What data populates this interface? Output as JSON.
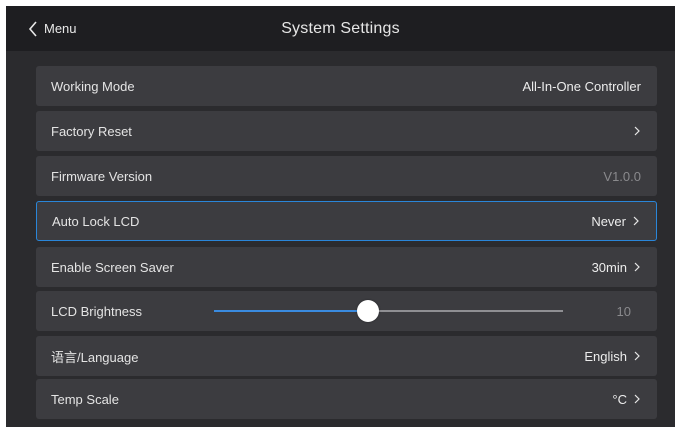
{
  "header": {
    "back_label": "Menu",
    "title": "System Settings"
  },
  "rows": [
    {
      "label": "Working Mode",
      "value": "All-In-One Controller"
    },
    {
      "label": "Factory Reset",
      "value": ""
    },
    {
      "label": "Firmware Version",
      "value": "V1.0.0"
    },
    {
      "label": "Auto Lock LCD",
      "value": "Never"
    },
    {
      "label": "Enable Screen Saver",
      "value": "30min"
    },
    {
      "label": "LCD Brightness",
      "value": "10",
      "slider_fraction": 0.44
    },
    {
      "label": "语言/Language",
      "value": "English"
    },
    {
      "label": "Temp Scale",
      "value": "°C"
    }
  ],
  "colors": {
    "accent": "#2a86d9",
    "background": "#2b2b2e",
    "row": "#3c3c40",
    "header": "#1e1e21"
  }
}
